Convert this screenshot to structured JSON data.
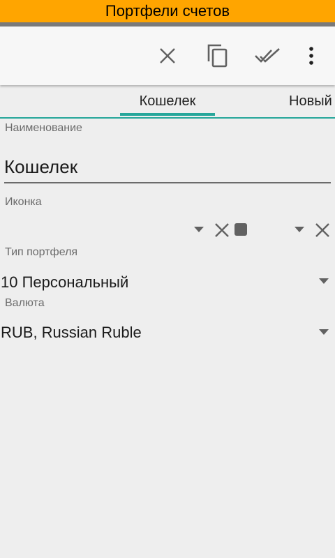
{
  "app": {
    "title": "Портфели счетов",
    "title_bg": "#ffa500",
    "accent": "#26a69a"
  },
  "toolbar": {
    "actions": [
      {
        "name": "close",
        "icon": "close-icon"
      },
      {
        "name": "copy",
        "icon": "copy-icon"
      },
      {
        "name": "done-all",
        "icon": "done-all-icon"
      },
      {
        "name": "more",
        "icon": "more-vert-icon"
      }
    ]
  },
  "tabs": [
    {
      "label": "Кошелек",
      "selected": true
    },
    {
      "label": "Новый",
      "selected": false
    }
  ],
  "form": {
    "name": {
      "label": "Наименование",
      "value": "Кошелек"
    },
    "icon": {
      "label": "Иконка"
    },
    "portfolio_type": {
      "label": "Тип портфеля",
      "value": "10 Персональный"
    },
    "currency": {
      "label": "Валюта",
      "value": "RUB, Russian Ruble"
    }
  }
}
